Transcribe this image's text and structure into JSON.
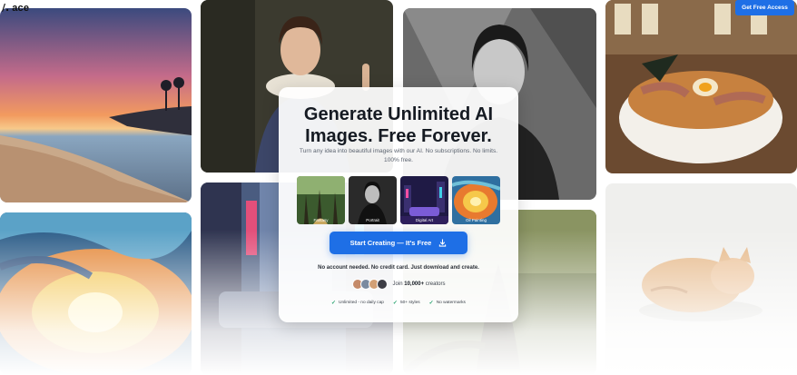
{
  "logo": {
    "mark": "/.",
    "text": "ace"
  },
  "header": {
    "cta_label": "Get Free Access"
  },
  "hero": {
    "headline_line1": "Generate Unlimited AI",
    "headline_line2": "Images. Free Forever.",
    "subtext": "Turn any idea into beautiful images with our AI. No subscriptions. No limits. 100% free.",
    "styles": [
      {
        "label": "Fantasy",
        "icon": "forest-thumbnail"
      },
      {
        "label": "Portrait",
        "icon": "portrait-thumbnail"
      },
      {
        "label": "Digital Art",
        "icon": "cyberpunk-city-thumbnail"
      },
      {
        "label": "Oil Painting",
        "icon": "oil-painting-thumbnail"
      }
    ],
    "cta_label": "Start Creating — It's Free",
    "note": "No account needed. No credit card. Just download and create.",
    "social_proof_prefix": "Join",
    "social_proof_count": "10,000+",
    "social_proof_suffix": "creators",
    "features": [
      "Unlimited - no daily cap",
      "50+ styles",
      "No watermarks"
    ]
  },
  "gallery": [
    {
      "icon": "sunset-beach-image"
    },
    {
      "icon": "renaissance-portrait-image"
    },
    {
      "icon": "bw-portrait-image"
    },
    {
      "icon": "ramen-bowl-image"
    },
    {
      "icon": "abstract-painting-image"
    },
    {
      "icon": "cyberpunk-street-image"
    },
    {
      "icon": "forest-tree-image"
    },
    {
      "icon": "sleeping-cat-image"
    }
  ],
  "colors": {
    "accent": "#1e6fe6",
    "check": "#22a06b",
    "text": "#151a22"
  }
}
